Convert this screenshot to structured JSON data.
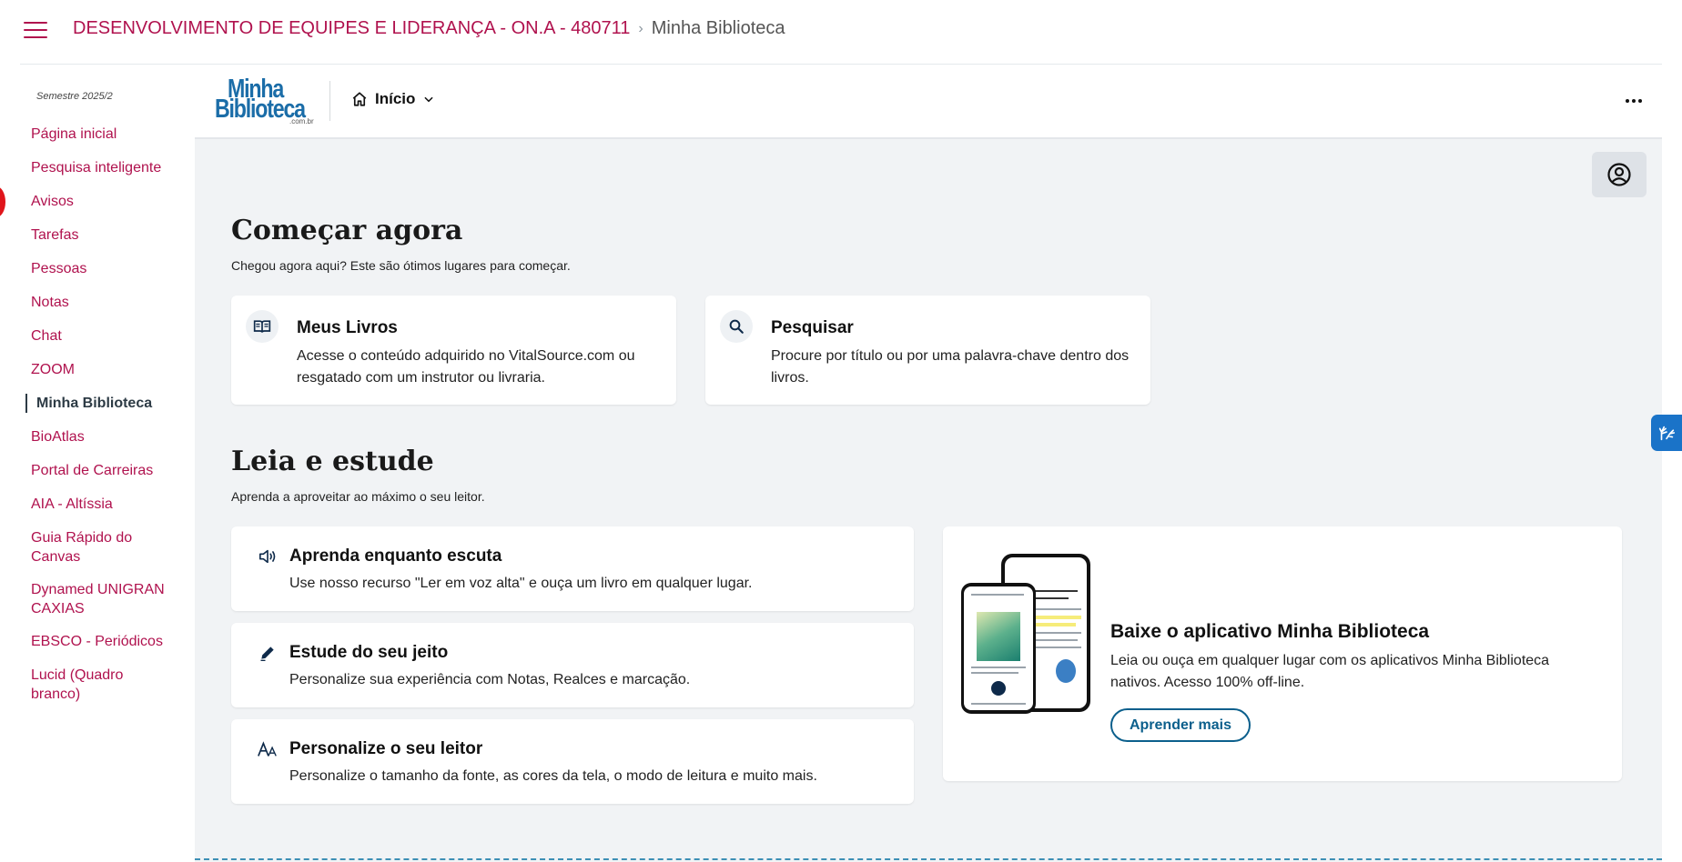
{
  "header": {
    "course": "DESENVOLVIMENTO DE EQUIPES E LIDERANÇA - ON.A - 480711",
    "separator": "›",
    "current": "Minha Biblioteca"
  },
  "sidebar": {
    "term": "Semestre 2025/2",
    "items": [
      {
        "label": "Página inicial"
      },
      {
        "label": "Pesquisa inteligente"
      },
      {
        "label": "Avisos"
      },
      {
        "label": "Tarefas"
      },
      {
        "label": "Pessoas"
      },
      {
        "label": "Notas"
      },
      {
        "label": "Chat"
      },
      {
        "label": "ZOOM"
      },
      {
        "label": "Minha Biblioteca",
        "active": true
      },
      {
        "label": "BioAtlas"
      },
      {
        "label": "Portal de Carreiras"
      },
      {
        "label": "AIA - Altíssia"
      },
      {
        "label": "Guia Rápido do Canvas"
      },
      {
        "label": "Dynamed UNIGRAN CAXIAS"
      },
      {
        "label": "EBSCO - Periódicos"
      },
      {
        "label": "Lucid (Quadro branco)"
      }
    ]
  },
  "app": {
    "logo": {
      "line1": "Minha",
      "line2": "Biblioteca",
      "domain": ".com.br"
    },
    "home_label": "Início",
    "start": {
      "title": "Começar agora",
      "subtitle": "Chegou agora aqui? Este são ótimos lugares para começar.",
      "cards": [
        {
          "icon": "book-open-icon",
          "title": "Meus Livros",
          "desc_line1": "Acesse o conteúdo adquirido no VitalSource.com ou",
          "desc_line2": "resgatado com um instrutor ou livraria."
        },
        {
          "icon": "search-icon",
          "title": "Pesquisar",
          "desc_line1": "Procure por título ou por uma palavra-chave dentro dos",
          "desc_line2": "livros."
        }
      ]
    },
    "read": {
      "title": "Leia e estude",
      "subtitle": "Aprenda a aproveitar ao máximo o seu leitor.",
      "features": [
        {
          "icon": "speaker-icon",
          "title": "Aprenda enquanto escuta",
          "desc": "Use nosso recurso \"Ler em voz alta\" e ouça um livro em qualquer lugar."
        },
        {
          "icon": "pencil-icon",
          "title": "Estude do seu jeito",
          "desc": "Personalize sua experiência com Notas, Realces e marcação."
        },
        {
          "icon": "font-size-icon",
          "title": "Personalize o seu leitor",
          "desc": "Personalize o tamanho da fonte, as cores da tela, o modo de leitura e muito mais."
        }
      ]
    },
    "promo": {
      "title": "Baixe o aplicativo Minha Biblioteca",
      "desc_line1": "Leia ou ouça em qualquer lugar com os aplicativos Minha Biblioteca",
      "desc_line2": "nativos. Acesso 100% off-line.",
      "button": "Aprender mais"
    }
  },
  "colors": {
    "brand": "#b0124e",
    "link_blue": "#0b5f8c",
    "logo_blue": "#1b6da8",
    "notification": "#e0151b",
    "accessibility": "#1a73c8"
  }
}
